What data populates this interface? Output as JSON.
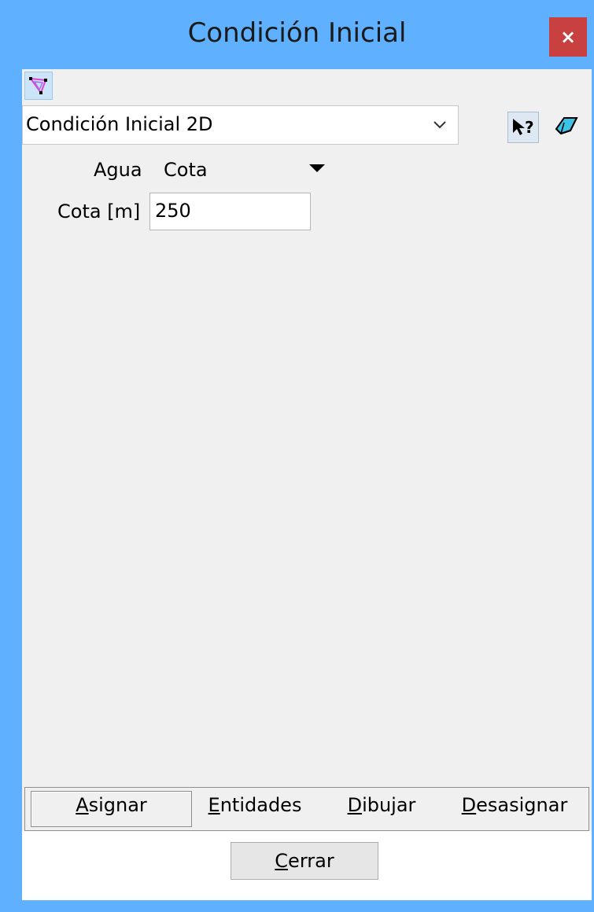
{
  "window": {
    "title": "Condición Inicial",
    "close_glyph": "×"
  },
  "toolbar": {
    "tool_icon": "draw-polygon-icon"
  },
  "condition_select": {
    "value": "Condición Inicial 2D"
  },
  "side_icons": {
    "help": "help-pointer-icon",
    "eraser": "eraser-icon"
  },
  "fields": {
    "agua_label": "Agua",
    "agua_value": "Cota",
    "cota_label": "Cota [m]",
    "cota_value": "250"
  },
  "tabs": [
    {
      "label_mnemonic": "A",
      "label_rest": "signar"
    },
    {
      "label_mnemonic": "E",
      "label_rest": "ntidades"
    },
    {
      "label_mnemonic": "D",
      "label_rest": "ibujar"
    },
    {
      "label_mnemonic": "D",
      "label_rest": "esasignar"
    }
  ],
  "footer": {
    "close_mnemonic": "C",
    "close_rest": "errar"
  },
  "colors": {
    "frame": "#5fb0ff",
    "close": "#c84140",
    "client": "#f0f0f0"
  }
}
